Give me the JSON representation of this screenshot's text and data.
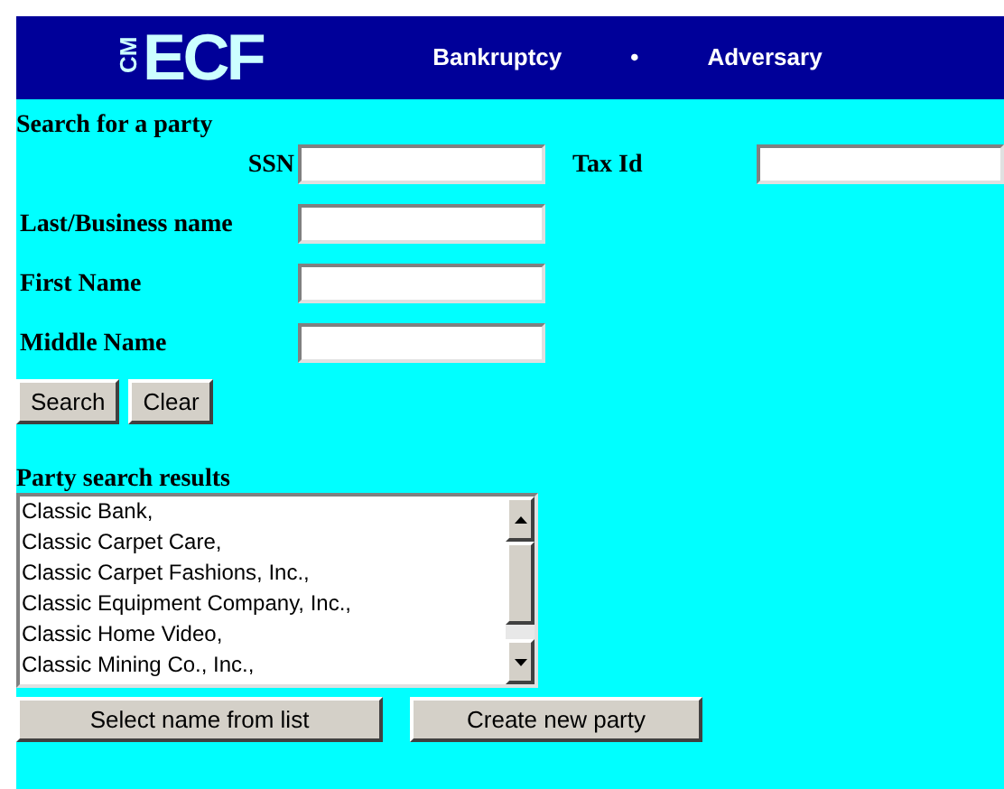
{
  "header": {
    "logo_small": "CM",
    "logo": "ECF",
    "nav": [
      "Bankruptcy",
      "•",
      "Adversary"
    ]
  },
  "search": {
    "title": "Search for a party",
    "fields": [
      {
        "label": "SSN"
      },
      {
        "label": "Tax Id"
      },
      {
        "label": "Last/Business name"
      },
      {
        "label": "First Name"
      },
      {
        "label": "Middle Name"
      }
    ],
    "buttons": [
      "Search",
      "Clear"
    ]
  },
  "results": {
    "title": "Party search results",
    "items": [
      {
        "text": "Classic Bank,",
        "selected": false
      },
      {
        "text": "Classic Carpet Care,",
        "selected": false
      },
      {
        "text": "Classic Carpet Fashions, Inc.,",
        "selected": false
      },
      {
        "text": "Classic Equipment Company, Inc.,",
        "selected": false
      },
      {
        "text": "Classic Home Video,",
        "selected": false
      },
      {
        "text": "Classic Mining Co., Inc.,",
        "selected": false
      }
    ],
    "buttons": [
      "Select name from list",
      "Create new party"
    ]
  }
}
